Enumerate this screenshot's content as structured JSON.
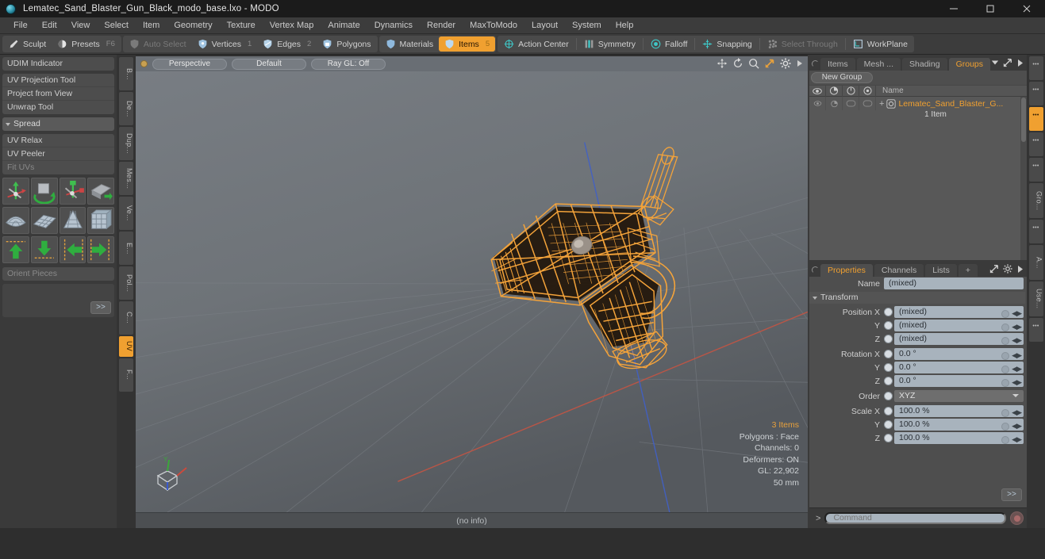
{
  "titlebar": {
    "title": "Lematec_Sand_Blaster_Gun_Black_modo_base.lxo - MODO",
    "minimize": "—",
    "maximize": "□",
    "close": "✕"
  },
  "menubar": {
    "items": [
      "File",
      "Edit",
      "View",
      "Select",
      "Item",
      "Geometry",
      "Texture",
      "Vertex Map",
      "Animate",
      "Dynamics",
      "Render",
      "MaxToModo",
      "Layout",
      "System",
      "Help"
    ]
  },
  "toolbar": {
    "groups": [
      {
        "items": [
          {
            "label": "Sculpt",
            "icon": "brush-icon",
            "state": "normal",
            "num": ""
          },
          {
            "label": "Presets",
            "icon": "sphere-icon",
            "state": "normal",
            "num": "F6"
          }
        ]
      },
      {
        "items": [
          {
            "label": "Auto Select",
            "icon": "shield-grey-icon",
            "state": "dim",
            "num": ""
          },
          {
            "label": "Vertices",
            "icon": "vertices-icon",
            "state": "normal",
            "num": "1"
          },
          {
            "label": "Edges",
            "icon": "edges-icon",
            "state": "normal",
            "num": "2"
          },
          {
            "label": "Polygons",
            "icon": "polygons-icon",
            "state": "normal",
            "num": ""
          }
        ]
      },
      {
        "items": [
          {
            "label": "Materials",
            "icon": "materials-icon",
            "state": "normal",
            "num": ""
          },
          {
            "label": "Items",
            "icon": "items-icon",
            "state": "selected",
            "num": "5"
          }
        ]
      },
      {
        "items": [
          {
            "label": "Action Center",
            "icon": "action-center-icon",
            "state": "normal",
            "num": ""
          },
          {
            "label": "Symmetry",
            "icon": "symmetry-icon",
            "state": "normal",
            "num": ""
          },
          {
            "label": "Falloff",
            "icon": "falloff-icon",
            "state": "normal",
            "num": ""
          },
          {
            "label": "Snapping",
            "icon": "snapping-icon",
            "state": "normal",
            "num": ""
          },
          {
            "label": "Select Through",
            "icon": "select-through-icon",
            "state": "dim",
            "num": ""
          },
          {
            "label": "WorkPlane",
            "icon": "workplane-icon",
            "state": "normal",
            "num": ""
          }
        ]
      }
    ]
  },
  "leftpanel": {
    "block1": [
      "UDIM Indicator"
    ],
    "block2": [
      "UV Projection Tool",
      "Project from View",
      "Unwrap Tool"
    ],
    "spread_header": "Spread",
    "block3": [
      {
        "label": "UV Relax",
        "dim": false
      },
      {
        "label": "UV Peeler",
        "dim": false
      },
      {
        "label": "Fit UVs",
        "dim": true
      }
    ],
    "icon_rows": [
      [
        "uv-move-icon",
        "uv-rotate-icon",
        "uv-scale-icon",
        "uv-flip-icon"
      ],
      [
        "uv-sphere-unwrap-icon",
        "uv-planar-unwrap-icon",
        "uv-cone-unwrap-icon",
        "uv-box-unwrap-icon"
      ],
      [
        "uv-align-up-icon",
        "uv-align-down-icon",
        "uv-align-left-icon",
        "uv-align-right-icon"
      ]
    ],
    "orient_pieces": "Orient Pieces",
    "more_label": ">>",
    "tabs": [
      "B...",
      "De...",
      "Dup...",
      "Mes...",
      "Ve...",
      "E...",
      "Pol...",
      "C...",
      "UV",
      "F..."
    ],
    "selected_tab": "UV"
  },
  "viewport": {
    "mode_dot": "viewport-mode-dot",
    "pills": [
      "Perspective",
      "Default",
      "Ray GL: Off"
    ],
    "tool_icons": [
      "pan-icon",
      "rotate-icon",
      "zoom-icon",
      "fit-icon",
      "gear-icon",
      "chevron-right-icon"
    ],
    "info": [
      "3 Items",
      "Polygons : Face",
      "Channels: 0",
      "Deformers: ON",
      "GL: 22,902",
      "50 mm"
    ],
    "footer": "(no info)",
    "axis_gizmo": {
      "x": "X",
      "y": "Y",
      "z": "Z"
    },
    "model_name": "sand-blaster-gun-wireframe"
  },
  "rightpanel": {
    "top_tabs": [
      "Items",
      "Mesh ...",
      "Shading",
      "Groups"
    ],
    "top_selected": "Groups",
    "new_group_button": "New Group",
    "grouplist": {
      "columns": [
        "eye-icon",
        "render-icon",
        "lock-icon",
        "select-icon"
      ],
      "name_header": "Name",
      "rows": [
        {
          "name": "Lematec_Sand_Blaster_G...",
          "sub": "1 Item",
          "icon": "group-icon"
        }
      ]
    },
    "prop_tabs": [
      "Properties",
      "Channels",
      "Lists",
      "+"
    ],
    "prop_selected": "Properties",
    "properties": {
      "name_label": "Name",
      "name_value": "(mixed)",
      "transform_header": "Transform",
      "rows": [
        {
          "label": "Position X",
          "value": "(mixed)",
          "type": "field"
        },
        {
          "label": "Y",
          "value": "(mixed)",
          "type": "field"
        },
        {
          "label": "Z",
          "value": "(mixed)",
          "type": "field"
        },
        {
          "label": "Rotation X",
          "value": "0.0 °",
          "type": "field"
        },
        {
          "label": "Y",
          "value": "0.0 °",
          "type": "field"
        },
        {
          "label": "Z",
          "value": "0.0 °",
          "type": "field"
        },
        {
          "label": "Order",
          "value": "XYZ",
          "type": "dropdown"
        },
        {
          "label": "Scale X",
          "value": "100.0 %",
          "type": "field"
        },
        {
          "label": "Y",
          "value": "100.0 %",
          "type": "field"
        },
        {
          "label": "Z",
          "value": "100.0 %",
          "type": "field"
        }
      ],
      "more_label": ">>"
    },
    "side_tabs": [
      "•••",
      "•••",
      "•••",
      "•••",
      "•••",
      "Gro...",
      "•••",
      "A...",
      "Use...",
      "•••"
    ],
    "side_selected_index": 2
  },
  "commandbar": {
    "prompt": "&gt;",
    "placeholder": "Command",
    "value": "Command",
    "record_icon": "record-icon"
  },
  "colors": {
    "accent": "#f0a030",
    "titlebar_bg": "#1b1b1b",
    "panel_bg": "#3a3a3a",
    "viewport_bg": "#6e7378",
    "field_bg": "#a8b3bd",
    "wireframe": "#f0a030"
  }
}
